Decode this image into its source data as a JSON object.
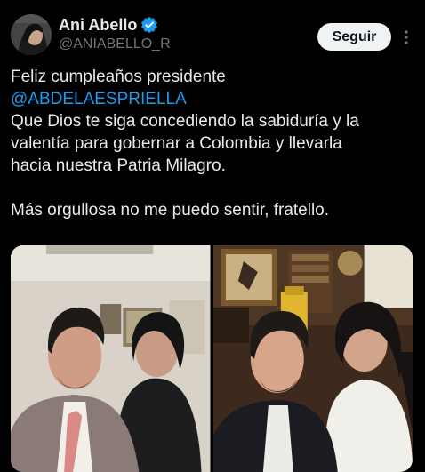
{
  "author": {
    "display_name": "Ani Abello",
    "handle": "@ANIABELLO_R",
    "verified": true,
    "avatar_icon": "avatar-photo"
  },
  "actions": {
    "follow_label": "Seguir",
    "more_icon": "more-options-icon"
  },
  "tweet": {
    "line1": "Feliz cumpleaños presidente",
    "mention": "@ABDELAESPRIELLA",
    "line3": "Que Dios te siga concediendo la sabiduría y la",
    "line4": "valentía para gobernar a Colombia y llevarla",
    "line5": "hacia nuestra Patria Milagro.",
    "line6": "Más orgullosa no me puedo sentir, fratello."
  },
  "media": {
    "photo_count": 2,
    "photos": [
      {
        "description_icon": "photo-selfie-office-light"
      },
      {
        "description_icon": "photo-selfie-office-wood"
      }
    ]
  },
  "colors": {
    "background": "#000000",
    "text": "#e7e9ea",
    "secondary_text": "#71767b",
    "mention": "#1d9bf0",
    "verified_badge": "#1d9bf0",
    "follow_button_bg": "#eff3f4"
  }
}
